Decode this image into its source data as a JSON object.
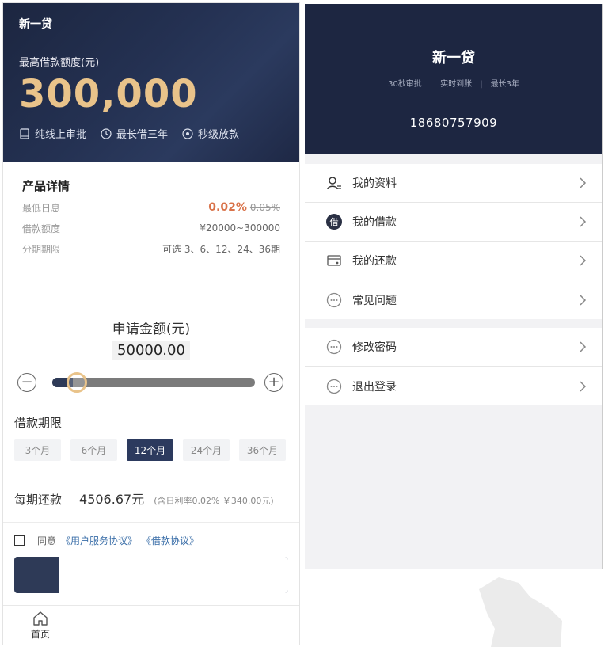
{
  "left": {
    "app_title": "新一贷",
    "max_label": "最高借款额度(元)",
    "max_amount": "300,000",
    "features": [
      {
        "icon": "tablet-icon",
        "label": "纯线上审批"
      },
      {
        "icon": "clock-icon",
        "label": "最长借三年"
      },
      {
        "icon": "eye-icon",
        "label": "秒级放款"
      }
    ],
    "details": {
      "title": "产品详情",
      "rate_label": "最低日息",
      "rate_value": "0.02%",
      "rate_old": "0.05%",
      "amount_label": "借款额度",
      "amount_value": "¥20000~300000",
      "period_label": "分期期限",
      "period_value": "可选 3、6、12、24、36期"
    },
    "apply": {
      "label": "申请金额(元)",
      "amount": "50000.00",
      "slider_fraction": 0.1
    },
    "term": {
      "title": "借款期限",
      "options": [
        "3个月",
        "6个月",
        "12个月",
        "24个月",
        "36个月"
      ],
      "selected_index": 2
    },
    "payment": {
      "label": "每期还款",
      "value": "4506.67元",
      "note": "(含日利率0.02% ￥340.00元)"
    },
    "agree": {
      "text": "同意",
      "link1": "《用户服务协议》",
      "link2": "《借款协议》"
    },
    "tabbar": {
      "home_label": "首页"
    }
  },
  "right": {
    "title": "新一贷",
    "tags": "30秒审批　|　实时到账　|　最长3年",
    "phone": "18680757909",
    "menu": [
      {
        "icon": "user-icon",
        "label": "我的资料"
      },
      {
        "icon": "loan-icon",
        "label": "我的借款"
      },
      {
        "icon": "repay-icon",
        "label": "我的还款"
      },
      {
        "icon": "faq-icon",
        "label": "常见问题"
      }
    ],
    "menu2": [
      {
        "icon": "password-icon",
        "label": "修改密码"
      },
      {
        "icon": "logout-icon",
        "label": "退出登录"
      }
    ]
  },
  "colors": {
    "navy": "#1d2641",
    "gold": "#e9c38a",
    "accent_rate": "#d9734a",
    "link": "#3a6ea8"
  }
}
